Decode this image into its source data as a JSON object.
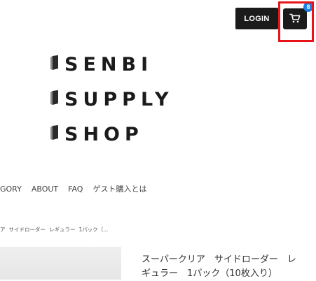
{
  "header": {
    "login_label": "LOGIN",
    "cart_count": "8",
    "cart_icon": "cart-icon"
  },
  "logo": {
    "lines": [
      "SENBI",
      "SUPPLY",
      "SHOP"
    ],
    "icon": "block-icon"
  },
  "nav": {
    "items": [
      "GORY",
      "ABOUT",
      "FAQ",
      "ゲスト購入とは"
    ]
  },
  "breadcrumb": {
    "items": [
      "ア",
      "サイドローダー",
      "レギュラー",
      "1パック（..."
    ]
  },
  "product": {
    "title_line1": "スーパークリア　サイドローダー　レ",
    "title_line2": "ギュラー　1パック（10枚入り）"
  },
  "colors": {
    "button_bg": "#1b1b1b",
    "badge": "#1d7fe0",
    "highlight": "#e8141a"
  }
}
